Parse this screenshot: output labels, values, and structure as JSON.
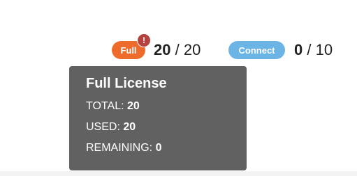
{
  "licenses": {
    "full": {
      "label": "Full",
      "alert_symbol": "!",
      "used": "20",
      "separator": "/",
      "total": "20",
      "color": "#ee6b2c",
      "alert_color": "#b5423e"
    },
    "connect": {
      "label": "Connect",
      "used": "0",
      "separator": "/",
      "total": "10",
      "color": "#6ab4e6"
    }
  },
  "tooltip": {
    "title": "Full License",
    "total_label": "TOTAL:",
    "total_value": "20",
    "used_label": "USED:",
    "used_value": "20",
    "remaining_label": "REMAINING:",
    "remaining_value": "0",
    "background": "#616161"
  }
}
